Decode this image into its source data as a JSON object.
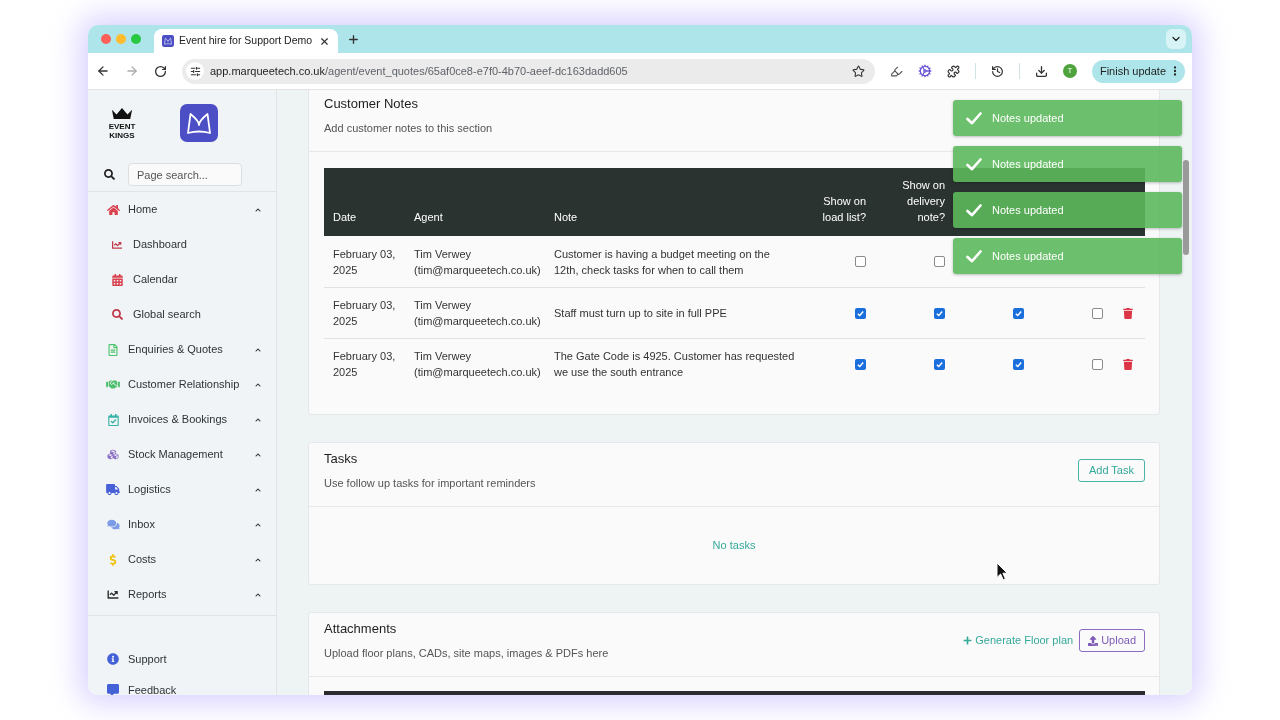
{
  "browser": {
    "tab_title": "Event hire for Support Demo",
    "url_host": "app.marqueetech.co.uk",
    "url_path": "/agent/event_quotes/65af0ce8-e7f0-4b70-aeef-dc163dadd605",
    "avatar": "T",
    "update_button": "Finish update"
  },
  "sidebar": {
    "brand": "EVENT KINGS",
    "search": {
      "placeholder": "Page search..."
    },
    "items": [
      {
        "label": "Home",
        "kind": "group",
        "children": [
          {
            "label": "Dashboard"
          },
          {
            "label": "Calendar"
          },
          {
            "label": "Global search"
          }
        ]
      },
      {
        "label": "Enquiries & Quotes",
        "kind": "group"
      },
      {
        "label": "Customer Relationship",
        "kind": "group"
      },
      {
        "label": "Invoices & Bookings",
        "kind": "group"
      },
      {
        "label": "Stock Management",
        "kind": "group"
      },
      {
        "label": "Logistics",
        "kind": "group"
      },
      {
        "label": "Inbox",
        "kind": "group"
      },
      {
        "label": "Costs",
        "kind": "group"
      },
      {
        "label": "Reports",
        "kind": "group"
      }
    ],
    "footer_items": [
      {
        "label": "Support"
      },
      {
        "label": "Feedback"
      }
    ]
  },
  "notes_card": {
    "title": "Customer Notes",
    "subtitle": "Add customer notes to this section",
    "table": {
      "columns": [
        "Date",
        "Agent",
        "Note",
        "Show on load list?",
        "Show on delivery note?"
      ],
      "rows": [
        {
          "date": "February 03, 2025",
          "agent": "Tim Verwey (tim@marqueetech.co.uk)",
          "note": "Customer is having a budget meeting on the 12th, check tasks for when to call them",
          "checks": [
            false,
            false
          ],
          "trash": false
        },
        {
          "date": "February 03, 2025",
          "agent": "Tim Verwey (tim@marqueetech.co.uk)",
          "note": "Staff must turn up to site in full PPE",
          "checks": [
            true,
            true,
            true,
            false
          ],
          "trash": true
        },
        {
          "date": "February 03, 2025",
          "agent": "Tim Verwey (tim@marqueetech.co.uk)",
          "note": "The Gate Code is 4925. Customer has requested we use the south entrance",
          "checks": [
            true,
            true,
            true,
            false
          ],
          "trash": true
        }
      ]
    }
  },
  "toasts": [
    {
      "message": "Notes updated"
    },
    {
      "message": "Notes updated"
    },
    {
      "message": "Notes updated"
    },
    {
      "message": "Notes updated"
    }
  ],
  "tasks_card": {
    "title": "Tasks",
    "subtitle": "Use follow up tasks for important reminders",
    "button": "Add Task",
    "empty_text": "No tasks"
  },
  "attachments_card": {
    "title": "Attachments",
    "subtitle": "Upload floor plans, CADs, site maps, images & PDFs here",
    "link": "Generate Floor plan",
    "button": "Upload"
  }
}
